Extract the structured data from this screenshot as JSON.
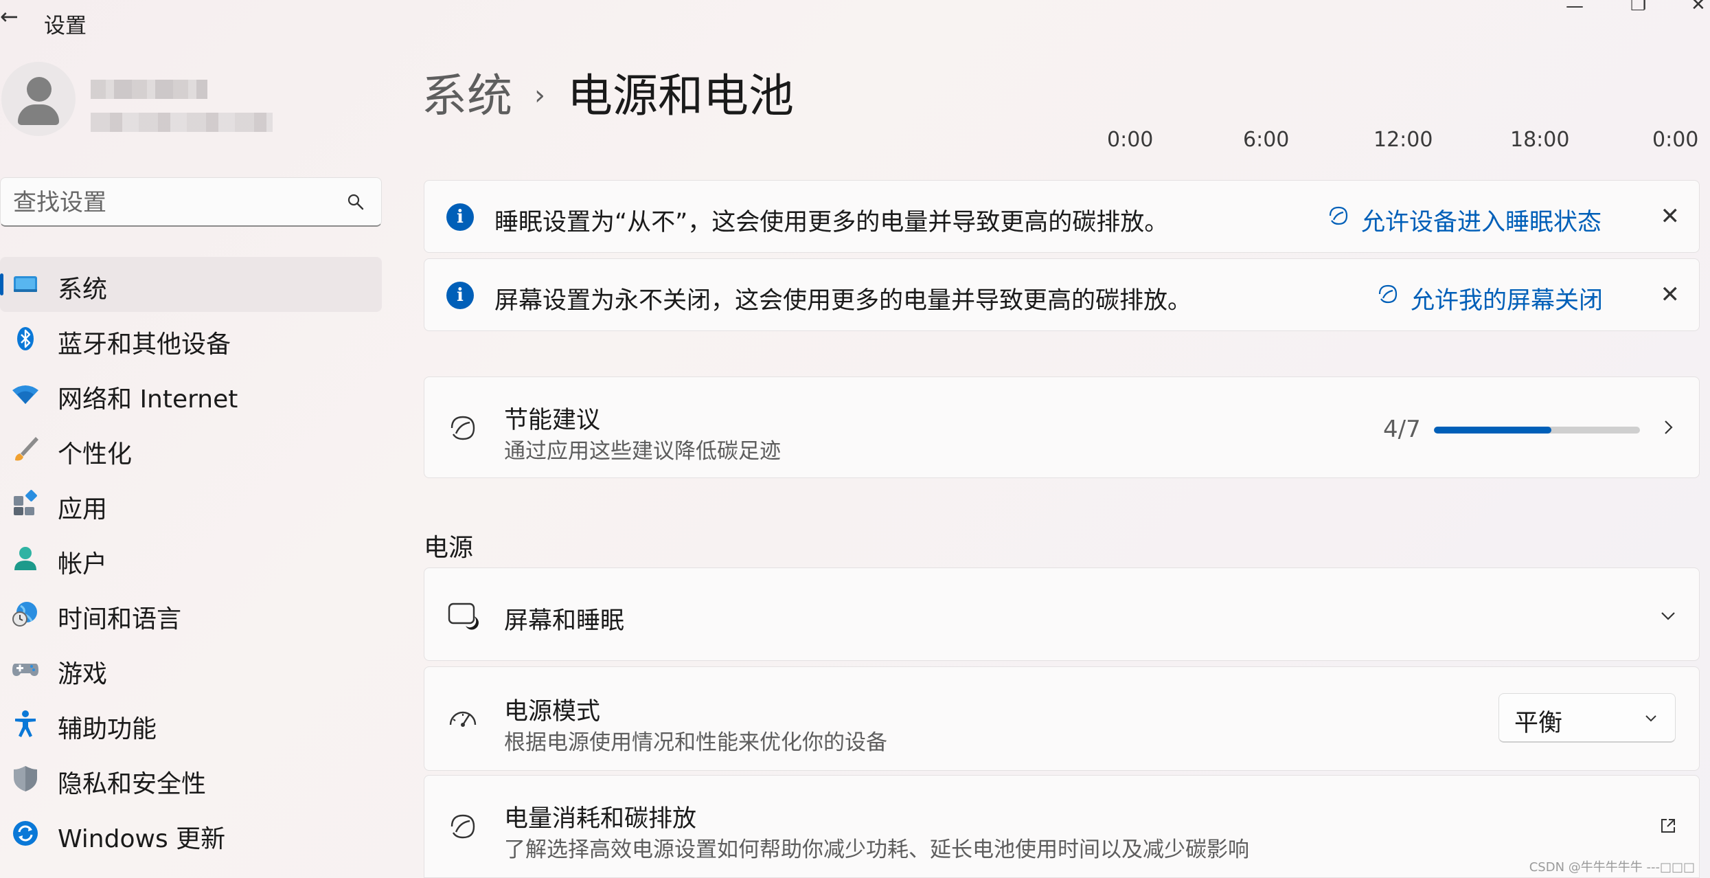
{
  "window": {
    "title": "设置",
    "back_icon": "←",
    "minimize_icon": "—",
    "restore_icon": "❐",
    "close_icon": "✕"
  },
  "search": {
    "placeholder": "查找设置"
  },
  "sidebar": {
    "items": [
      {
        "label": "系统",
        "icon": "system-monitor-icon",
        "active": true
      },
      {
        "label": "蓝牙和其他设备",
        "icon": "bluetooth-icon"
      },
      {
        "label": "网络和 Internet",
        "icon": "wifi-icon"
      },
      {
        "label": "个性化",
        "icon": "paintbrush-icon"
      },
      {
        "label": "应用",
        "icon": "apps-icon"
      },
      {
        "label": "帐户",
        "icon": "account-icon"
      },
      {
        "label": "时间和语言",
        "icon": "globe-clock-icon"
      },
      {
        "label": "游戏",
        "icon": "gamepad-icon"
      },
      {
        "label": "辅助功能",
        "icon": "accessibility-icon"
      },
      {
        "label": "隐私和安全性",
        "icon": "shield-icon"
      },
      {
        "label": "Windows 更新",
        "icon": "update-icon"
      }
    ]
  },
  "breadcrumb": {
    "parent": "系统",
    "separator": "›",
    "current": "电源和电池"
  },
  "time_axis": [
    "0:00",
    "6:00",
    "12:00",
    "18:00",
    "0:00"
  ],
  "notices": [
    {
      "text": "睡眠设置为“从不”，这会使用更多的电量并导致更高的碳排放。",
      "action": "允许设备进入睡眠状态"
    },
    {
      "text": "屏幕设置为永不关闭，这会使用更多的电量并导致更高的碳排放。",
      "action": "允许我的屏幕关闭"
    }
  ],
  "energy_recommendations": {
    "title": "节能建议",
    "subtitle": "通过应用这些建议降低碳足迹",
    "progress_text": "4/7",
    "progress_fraction": 0.5714
  },
  "power_section": {
    "heading": "电源",
    "screen_sleep": {
      "title": "屏幕和睡眠"
    },
    "power_mode": {
      "title": "电源模式",
      "subtitle": "根据电源使用情况和性能来优化你的设备",
      "selected": "平衡"
    },
    "energy_usage": {
      "title": "电量消耗和碳排放",
      "subtitle": "了解选择高效电源设置如何帮助你减少功耗、延长电池使用时间以及减少碳影响"
    }
  },
  "watermark": "CSDN @牛牛牛牛牛 ---□□□",
  "colors": {
    "accent": "#005fb8",
    "track": "#cfcfcf"
  }
}
